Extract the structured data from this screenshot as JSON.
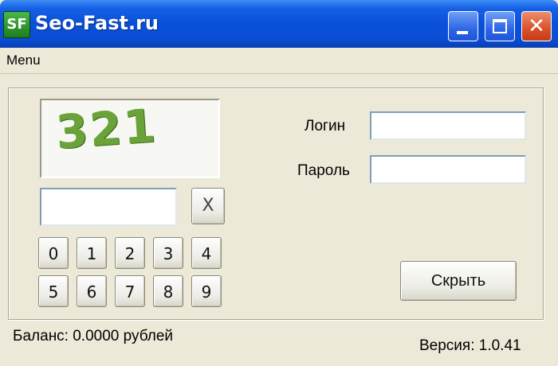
{
  "window": {
    "app_icon_text": "SF",
    "title": "Seo-Fast.ru",
    "close_glyph": "✕"
  },
  "menu": {
    "items": [
      "Menu"
    ]
  },
  "captcha": {
    "text": "321",
    "clear_label": "X"
  },
  "keypad": {
    "keys": [
      "0",
      "1",
      "2",
      "3",
      "4",
      "5",
      "6",
      "7",
      "8",
      "9"
    ]
  },
  "login": {
    "label": "Логин",
    "value": ""
  },
  "password": {
    "label": "Пароль",
    "value": ""
  },
  "hide_button": {
    "label": "Скрыть"
  },
  "status": {
    "balance": "Баланс: 0.0000 рублей",
    "version": "Версия: 1.0.41"
  }
}
